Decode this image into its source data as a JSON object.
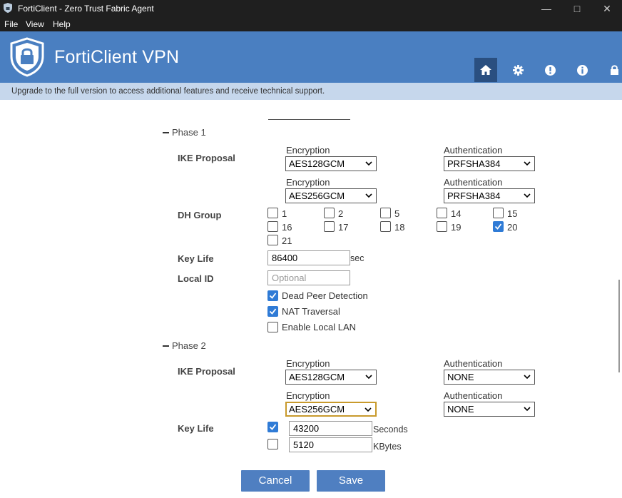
{
  "window": {
    "title": "FortiClient - Zero Trust Fabric Agent"
  },
  "menu": {
    "file": "File",
    "view": "View",
    "help": "Help"
  },
  "header": {
    "brand": "FortiClient VPN"
  },
  "banner": {
    "text": "Upgrade to the full version to access additional features and receive technical support."
  },
  "phase1": {
    "toggle": "Phase 1",
    "ike_label": "IKE Proposal",
    "proposals": [
      {
        "enc_label": "Encryption",
        "enc_value": "AES128GCM",
        "auth_label": "Authentication",
        "auth_value": "PRFSHA384"
      },
      {
        "enc_label": "Encryption",
        "enc_value": "AES256GCM",
        "auth_label": "Authentication",
        "auth_value": "PRFSHA384"
      }
    ],
    "dh_label": "DH Group",
    "dh_groups": [
      {
        "label": "1",
        "checked": false
      },
      {
        "label": "2",
        "checked": false
      },
      {
        "label": "5",
        "checked": false
      },
      {
        "label": "14",
        "checked": false
      },
      {
        "label": "15",
        "checked": false
      },
      {
        "label": "16",
        "checked": false
      },
      {
        "label": "17",
        "checked": false
      },
      {
        "label": "18",
        "checked": false
      },
      {
        "label": "19",
        "checked": false
      },
      {
        "label": "20",
        "checked": true
      },
      {
        "label": "21",
        "checked": false
      }
    ],
    "keylife_label": "Key Life",
    "keylife_value": "86400",
    "keylife_unit": "sec",
    "localid_label": "Local ID",
    "localid_placeholder": "Optional",
    "options": [
      {
        "label": "Dead Peer Detection",
        "checked": true
      },
      {
        "label": "NAT Traversal",
        "checked": true
      },
      {
        "label": "Enable Local LAN",
        "checked": false
      }
    ]
  },
  "phase2": {
    "toggle": "Phase 2",
    "ike_label": "IKE Proposal",
    "proposals": [
      {
        "enc_label": "Encryption",
        "enc_value": "AES128GCM",
        "auth_label": "Authentication",
        "auth_value": "NONE"
      },
      {
        "enc_label": "Encryption",
        "enc_value": "AES256GCM",
        "auth_label": "Authentication",
        "auth_value": "NONE"
      }
    ],
    "keylife_label": "Key Life",
    "keylife_seconds": {
      "checked": true,
      "value": "43200",
      "unit": "Seconds"
    },
    "keylife_kbytes": {
      "checked": false,
      "value": "5120",
      "unit": "KBytes"
    }
  },
  "buttons": {
    "cancel": "Cancel",
    "save": "Save"
  },
  "colors": {
    "header": "#4a7fc1",
    "banner": "#c6d7ec",
    "button": "#4f7fc1",
    "checkbox": "#2f7bd6",
    "active_nav": "#2a4f80"
  }
}
